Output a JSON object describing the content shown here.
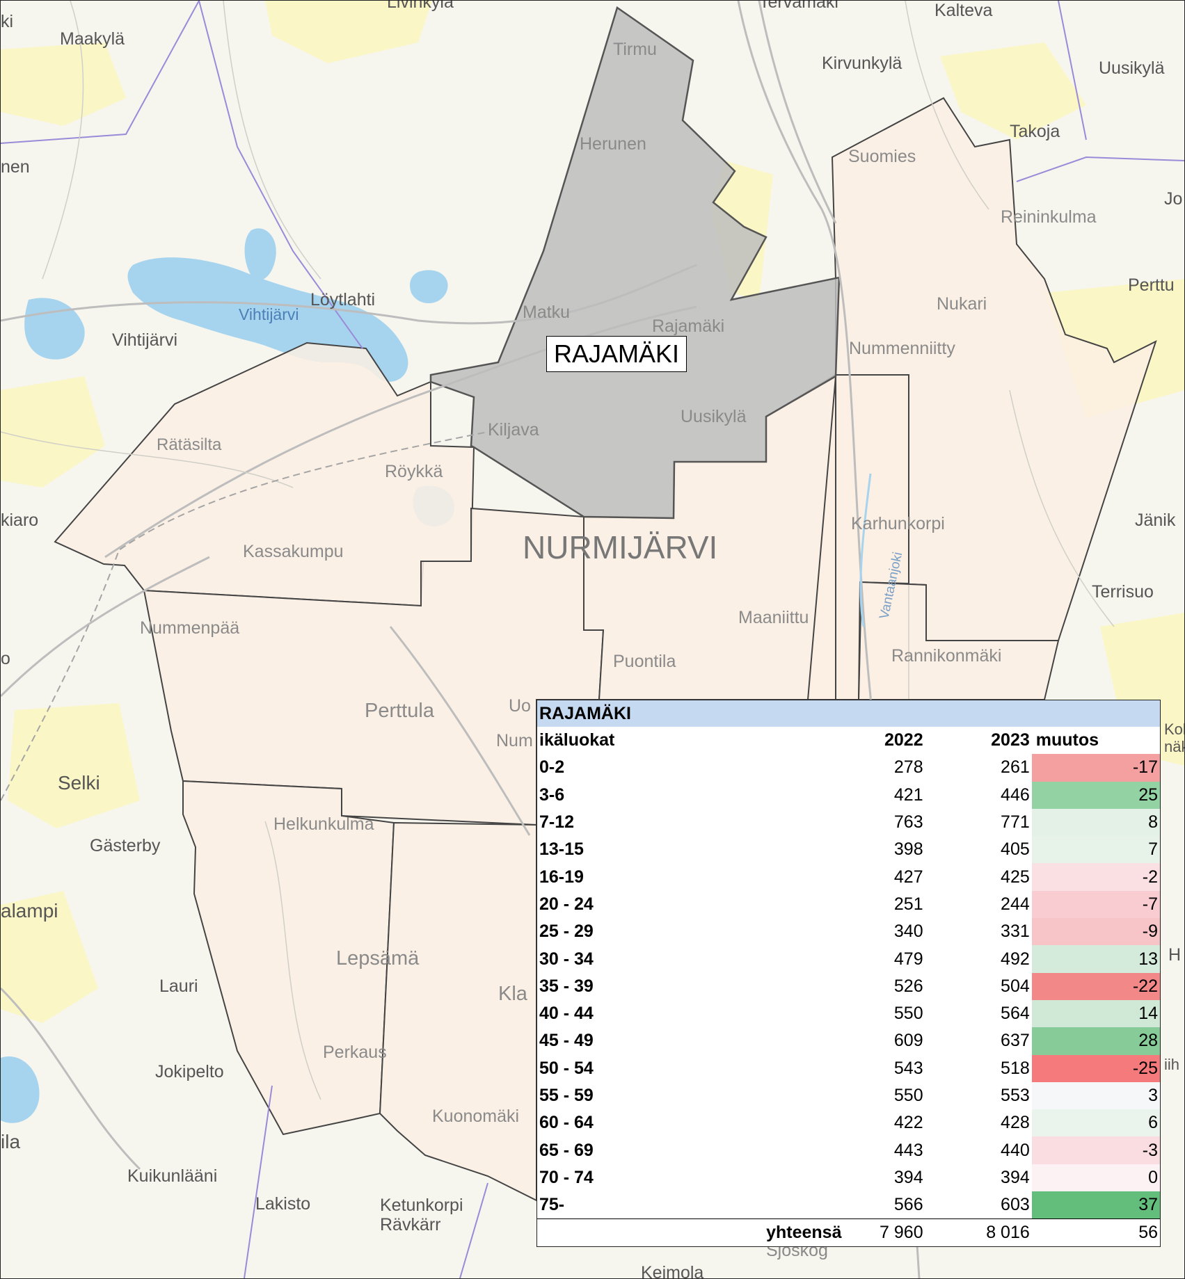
{
  "map": {
    "highlight_label": "RAJAMÄKI",
    "municipality_label": "NURMIJÄRVI",
    "places": [
      "Maakylä",
      "Livinkylä",
      "Tervamäki",
      "Kalteva",
      "Kirvunkylä",
      "Uusikylä",
      "Takoja",
      "Jo",
      "Reininkulma",
      "Perttu",
      "Tirmu",
      "Herunen",
      "Suomies",
      "Nukari",
      "Löytlahti",
      "Vihtijärvi",
      "Vihtijärvi",
      "Matku",
      "Rajamäki",
      "Nummenniitty",
      "Kiljava",
      "Uusikylä",
      "Rätäsilta",
      "Röykkä",
      "Kassakumpu",
      "Karhunkorpi",
      "Jänik",
      "Terrisuo",
      "Nummenpää",
      "Maaniittu",
      "Vantaanjoki",
      "Puontila",
      "Rannikonmäki",
      "Perttula",
      "Uo",
      "Num",
      "Selki",
      "Gästerby",
      "Helkunkulma",
      "alampi",
      "Lepsämä",
      "Kla",
      "Lauri",
      "Jokipelto",
      "Perkaus",
      "Kuonomäki",
      "ila",
      "Kuikunlääni",
      "Lakisto",
      "Ketunkorpi",
      "Rävkärr",
      "Sjöskog",
      "Keimola",
      "kiaro",
      "nen",
      "ki",
      "Koli",
      "näk",
      "H",
      "iih",
      "o"
    ]
  },
  "table": {
    "title": "RAJAMÄKI",
    "headers": {
      "label": "ikäluokat",
      "y1": "2022",
      "y2": "2023",
      "change": "muutos"
    },
    "rows": [
      {
        "label": "0-2",
        "y1": "278",
        "y2": "261",
        "change": "-17",
        "color": "#f4a0a0"
      },
      {
        "label": "3-6",
        "y1": "421",
        "y2": "446",
        "change": "25",
        "color": "#93d2a2"
      },
      {
        "label": "7-12",
        "y1": "763",
        "y2": "771",
        "change": "8",
        "color": "#e4f1e6"
      },
      {
        "label": "13-15",
        "y1": "398",
        "y2": "405",
        "change": "7",
        "color": "#e7f3e9"
      },
      {
        "label": "16-19",
        "y1": "427",
        "y2": "425",
        "change": "-2",
        "color": "#fbe0e3"
      },
      {
        "label": "20 - 24",
        "y1": "251",
        "y2": "244",
        "change": "-7",
        "color": "#f8ccd0"
      },
      {
        "label": "25 - 29",
        "y1": "340",
        "y2": "331",
        "change": "-9",
        "color": "#f7c4c8"
      },
      {
        "label": "30 - 34",
        "y1": "479",
        "y2": "492",
        "change": "13",
        "color": "#d4eadb"
      },
      {
        "label": "35 - 39",
        "y1": "526",
        "y2": "504",
        "change": "-22",
        "color": "#f38888"
      },
      {
        "label": "40 - 44",
        "y1": "550",
        "y2": "564",
        "change": "14",
        "color": "#d0e9d6"
      },
      {
        "label": "45 - 49",
        "y1": "609",
        "y2": "637",
        "change": "28",
        "color": "#87cc98"
      },
      {
        "label": "50 - 54",
        "y1": "543",
        "y2": "518",
        "change": "-25",
        "color": "#f47a7b"
      },
      {
        "label": "55 - 59",
        "y1": "550",
        "y2": "553",
        "change": "3",
        "color": "#f6f7f9"
      },
      {
        "label": "60 - 64",
        "y1": "422",
        "y2": "428",
        "change": "6",
        "color": "#ebf4ec"
      },
      {
        "label": "65 - 69",
        "y1": "443",
        "y2": "440",
        "change": "-3",
        "color": "#fadde0"
      },
      {
        "label": "70 - 74",
        "y1": "394",
        "y2": "394",
        "change": "0",
        "color": "#fcf2f4"
      },
      {
        "label": "75-",
        "y1": "566",
        "y2": "603",
        "change": "37",
        "color": "#63be7b"
      }
    ],
    "total": {
      "label": "yhteensä",
      "y1": "7 960",
      "y2": "8 016",
      "change": "56"
    }
  }
}
